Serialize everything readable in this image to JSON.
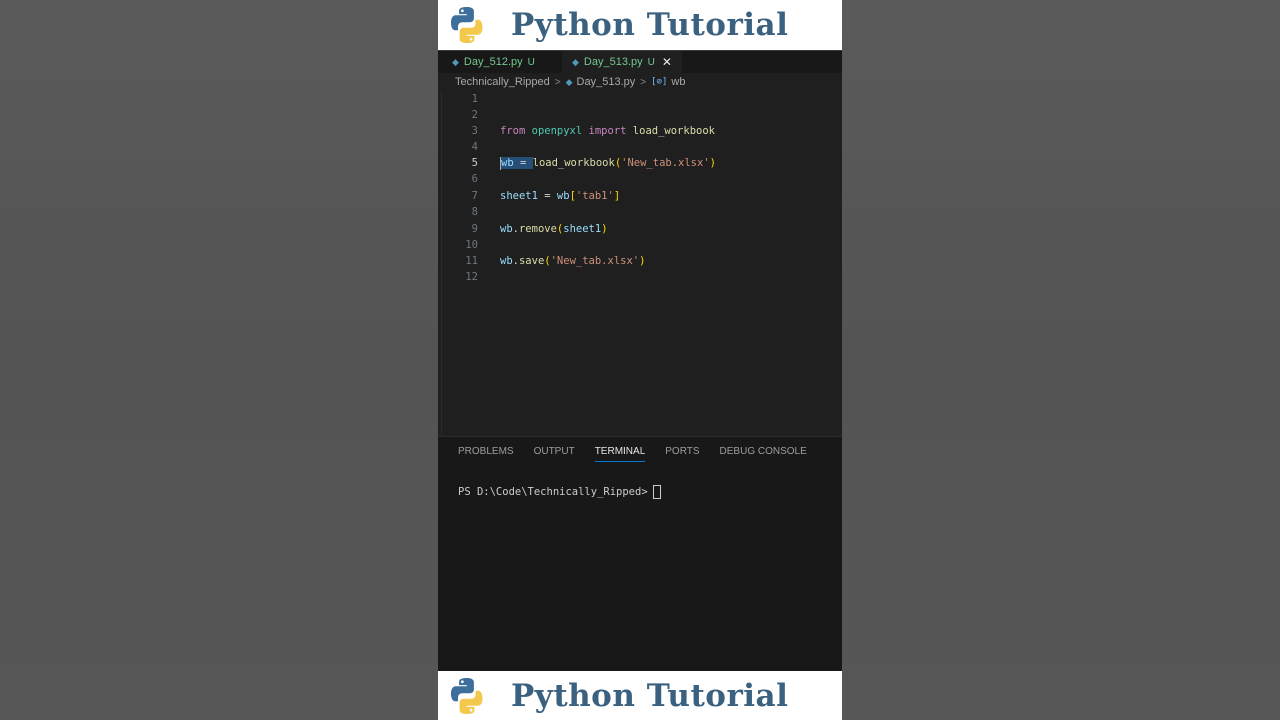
{
  "banner": {
    "title": "Python Tutorial",
    "colors": {
      "text": "#3b6180",
      "logo_blue": "#3e6f9c",
      "logo_yellow": "#f2c94c"
    }
  },
  "tabs": [
    {
      "name": "Day_512.py",
      "status": "U",
      "icon": "python-file-icon",
      "active": false
    },
    {
      "name": "Day_513.py",
      "status": "U",
      "icon": "python-file-icon",
      "active": true,
      "close": "✕"
    }
  ],
  "breadcrumb": {
    "folder": "Technically_Ripped",
    "file": "Day_513.py",
    "symbol_icon": "[⊘]",
    "symbol": "wb"
  },
  "editor": {
    "active_line": 5,
    "lines": [
      {
        "n": "1"
      },
      {
        "n": "2"
      },
      {
        "n": "3",
        "t": {
          "kw1": "from",
          "mod": "openpyxl",
          "kw2": "import",
          "fn": "load_workbook"
        }
      },
      {
        "n": "4"
      },
      {
        "n": "5",
        "t": {
          "var": "wb",
          "op": " = ",
          "fn": "load_workbook",
          "p1": "(",
          "str": "'New_tab.xlsx'",
          "p2": ")"
        }
      },
      {
        "n": "6"
      },
      {
        "n": "7",
        "t": {
          "var": "sheet1",
          "op": " = ",
          "var2": "wb",
          "b1": "[",
          "str": "'tab1'",
          "b2": "]"
        }
      },
      {
        "n": "8"
      },
      {
        "n": "9",
        "t": {
          "var": "wb",
          "dot": ".",
          "fn": "remove",
          "p1": "(",
          "arg": "sheet1",
          "p2": ")"
        }
      },
      {
        "n": "10"
      },
      {
        "n": "11",
        "t": {
          "var": "wb",
          "dot": ".",
          "fn": "save",
          "p1": "(",
          "str": "'New_tab.xlsx'",
          "p2": ")"
        }
      },
      {
        "n": "12"
      }
    ]
  },
  "panel": {
    "tabs": [
      "PROBLEMS",
      "OUTPUT",
      "TERMINAL",
      "PORTS",
      "DEBUG CONSOLE"
    ],
    "active_tab": "TERMINAL",
    "terminal_prompt": "PS D:\\Code\\Technically_Ripped>"
  }
}
